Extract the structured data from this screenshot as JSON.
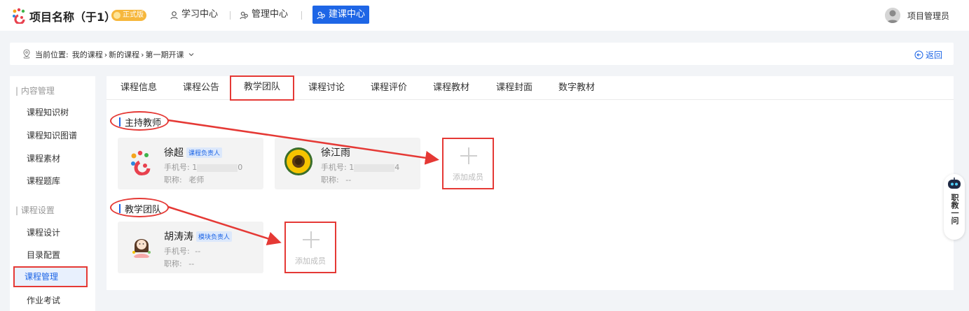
{
  "colors": {
    "accent": "#1e66e6",
    "highlight": "#e53935",
    "badge": "#f6b73c"
  },
  "header": {
    "project_title": "项目名称（于1）",
    "badge": "正式版",
    "nav": [
      {
        "label": "学习中心",
        "icon": "graduation-icon"
      },
      {
        "label": "管理中心",
        "icon": "users-icon"
      },
      {
        "label": "建课中心",
        "icon": "build-icon",
        "active": true
      }
    ],
    "user_name": "项目管理员"
  },
  "breadcrumb": {
    "prefix": "当前位置:",
    "items": [
      "我的课程",
      "新的课程",
      "第一期开课"
    ],
    "back": "返回"
  },
  "sidebar": {
    "groups": [
      {
        "label": "内容管理",
        "items": [
          "课程知识树",
          "课程知识图谱",
          "课程素材",
          "课程题库"
        ]
      },
      {
        "label": "课程设置",
        "items": [
          "课程设计",
          "目录配置",
          "课程管理",
          "作业考试"
        ]
      }
    ],
    "active_item": "课程管理"
  },
  "tabs": [
    "课程信息",
    "课程公告",
    "教学团队",
    "课程讨论",
    "课程评价",
    "课程教材",
    "课程封面",
    "数字教材"
  ],
  "active_tab": "教学团队",
  "sections": {
    "hosts": {
      "title": "主持教师",
      "members": [
        {
          "name": "徐超",
          "role": "课程负责人",
          "phone_label": "手机号:",
          "phone_start": "1",
          "phone_end": "0",
          "title_label": "职称:",
          "title_value": "老师"
        },
        {
          "name": "徐江雨",
          "role": "",
          "phone_label": "手机号:",
          "phone_start": "1",
          "phone_end": "4",
          "title_label": "职称:",
          "title_value": "--"
        }
      ],
      "add_label": "添加成员"
    },
    "team": {
      "title": "教学团队",
      "members": [
        {
          "name": "胡涛涛",
          "role": "模块负责人",
          "phone_label": "手机号:",
          "phone_value": "--",
          "title_label": "职称:",
          "title_value": "--"
        }
      ],
      "add_label": "添加成员"
    }
  },
  "assistant": {
    "label": "职教一问"
  }
}
